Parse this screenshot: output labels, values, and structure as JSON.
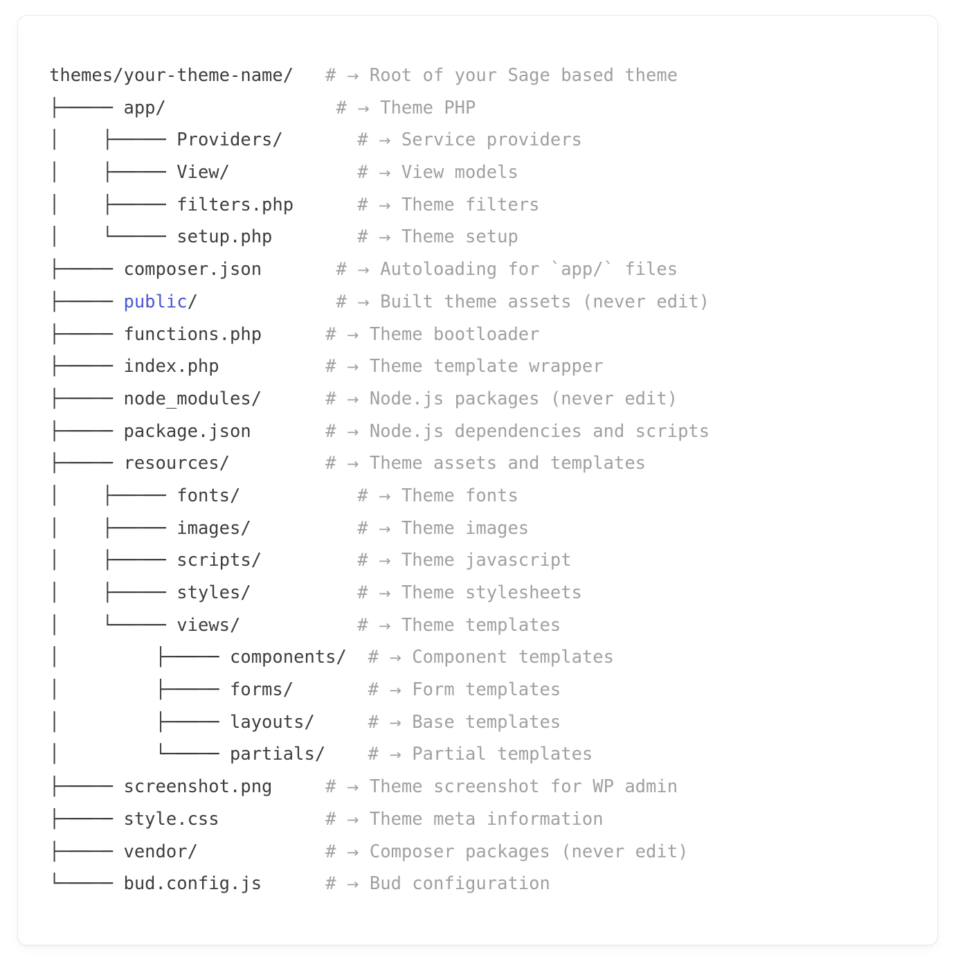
{
  "card": {
    "background": "#ffffff",
    "border_color": "#ececec"
  },
  "colors": {
    "text": "#3b3d3f",
    "comment": "#9fa0a2",
    "accent": "#4a56d2"
  },
  "tree": {
    "comment_marker": "#",
    "comment_arrow": "→",
    "rows": [
      {
        "prefix": "",
        "name": "themes/your-theme-name/",
        "accent": "",
        "suffix": "",
        "gap": "   ",
        "comment": "Root of your Sage based theme"
      },
      {
        "prefix": "├───── ",
        "name": "app/",
        "accent": "",
        "suffix": "",
        "gap": "                ",
        "comment": "Theme PHP"
      },
      {
        "prefix": "│    ├───── ",
        "name": "Providers/",
        "accent": "",
        "suffix": "",
        "gap": "       ",
        "comment": "Service providers"
      },
      {
        "prefix": "│    ├───── ",
        "name": "View/",
        "accent": "",
        "suffix": "",
        "gap": "            ",
        "comment": "View models"
      },
      {
        "prefix": "│    ├───── ",
        "name": "filters.php",
        "accent": "",
        "suffix": "",
        "gap": "      ",
        "comment": "Theme filters"
      },
      {
        "prefix": "│    └───── ",
        "name": "setup.php",
        "accent": "",
        "suffix": "",
        "gap": "        ",
        "comment": "Theme setup"
      },
      {
        "prefix": "├───── ",
        "name": "composer.json",
        "accent": "",
        "suffix": "",
        "gap": "       ",
        "comment": "Autoloading for `app/` files"
      },
      {
        "prefix": "├───── ",
        "name": "",
        "accent": "public",
        "suffix": "/",
        "gap": "             ",
        "comment": "Built theme assets (never edit)"
      },
      {
        "prefix": "├───── ",
        "name": "functions.php",
        "accent": "",
        "suffix": "",
        "gap": "      ",
        "comment": "Theme bootloader"
      },
      {
        "prefix": "├───── ",
        "name": "index.php",
        "accent": "",
        "suffix": "",
        "gap": "          ",
        "comment": "Theme template wrapper"
      },
      {
        "prefix": "├───── ",
        "name": "node_modules/",
        "accent": "",
        "suffix": "",
        "gap": "      ",
        "comment": "Node.js packages (never edit)"
      },
      {
        "prefix": "├───── ",
        "name": "package.json",
        "accent": "",
        "suffix": "",
        "gap": "       ",
        "comment": "Node.js dependencies and scripts"
      },
      {
        "prefix": "├───── ",
        "name": "resources/",
        "accent": "",
        "suffix": "",
        "gap": "         ",
        "comment": "Theme assets and templates"
      },
      {
        "prefix": "│    ├───── ",
        "name": "fonts/",
        "accent": "",
        "suffix": "",
        "gap": "           ",
        "comment": "Theme fonts"
      },
      {
        "prefix": "│    ├───── ",
        "name": "images/",
        "accent": "",
        "suffix": "",
        "gap": "          ",
        "comment": "Theme images"
      },
      {
        "prefix": "│    ├───── ",
        "name": "scripts/",
        "accent": "",
        "suffix": "",
        "gap": "         ",
        "comment": "Theme javascript"
      },
      {
        "prefix": "│    ├───── ",
        "name": "styles/",
        "accent": "",
        "suffix": "",
        "gap": "          ",
        "comment": "Theme stylesheets"
      },
      {
        "prefix": "│    └───── ",
        "name": "views/",
        "accent": "",
        "suffix": "",
        "gap": "           ",
        "comment": "Theme templates"
      },
      {
        "prefix": "│         ├───── ",
        "name": "components/",
        "accent": "",
        "suffix": "",
        "gap": "  ",
        "comment": "Component templates"
      },
      {
        "prefix": "│         ├───── ",
        "name": "forms/",
        "accent": "",
        "suffix": "",
        "gap": "       ",
        "comment": "Form templates"
      },
      {
        "prefix": "│         ├───── ",
        "name": "layouts/",
        "accent": "",
        "suffix": "",
        "gap": "     ",
        "comment": "Base templates"
      },
      {
        "prefix": "│         └───── ",
        "name": "partials/",
        "accent": "",
        "suffix": "",
        "gap": "    ",
        "comment": "Partial templates"
      },
      {
        "prefix": "├───── ",
        "name": "screenshot.png",
        "accent": "",
        "suffix": "",
        "gap": "     ",
        "comment": "Theme screenshot for WP admin"
      },
      {
        "prefix": "├───── ",
        "name": "style.css",
        "accent": "",
        "suffix": "",
        "gap": "          ",
        "comment": "Theme meta information"
      },
      {
        "prefix": "├───── ",
        "name": "vendor/",
        "accent": "",
        "suffix": "",
        "gap": "            ",
        "comment": "Composer packages (never edit)"
      },
      {
        "prefix": "└───── ",
        "name": "bud.config.js",
        "accent": "",
        "suffix": "",
        "gap": "      ",
        "comment": "Bud configuration"
      }
    ]
  }
}
